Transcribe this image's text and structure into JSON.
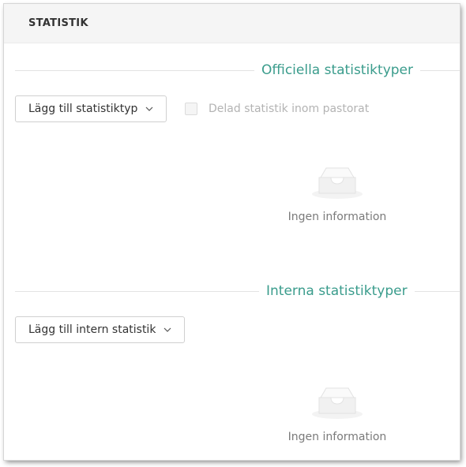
{
  "header": {
    "title": "STATISTIK"
  },
  "official": {
    "section_title": "Officiella statistiktyper",
    "add_button_label": "Lägg till statistiktyp",
    "shared_checkbox_label": "Delad statistik inom pastorat",
    "shared_checked": false,
    "empty_text": "Ingen information"
  },
  "internal": {
    "section_title": "Interna statistiktyper",
    "add_button_label": "Lägg till intern statistik",
    "empty_text": "Ingen information"
  },
  "icons": {
    "dropdown": "chevron-down-icon",
    "empty": "empty-inbox-icon"
  },
  "colors": {
    "section_title": "#3a9c8c",
    "header_bg": "#f5f5f5"
  }
}
